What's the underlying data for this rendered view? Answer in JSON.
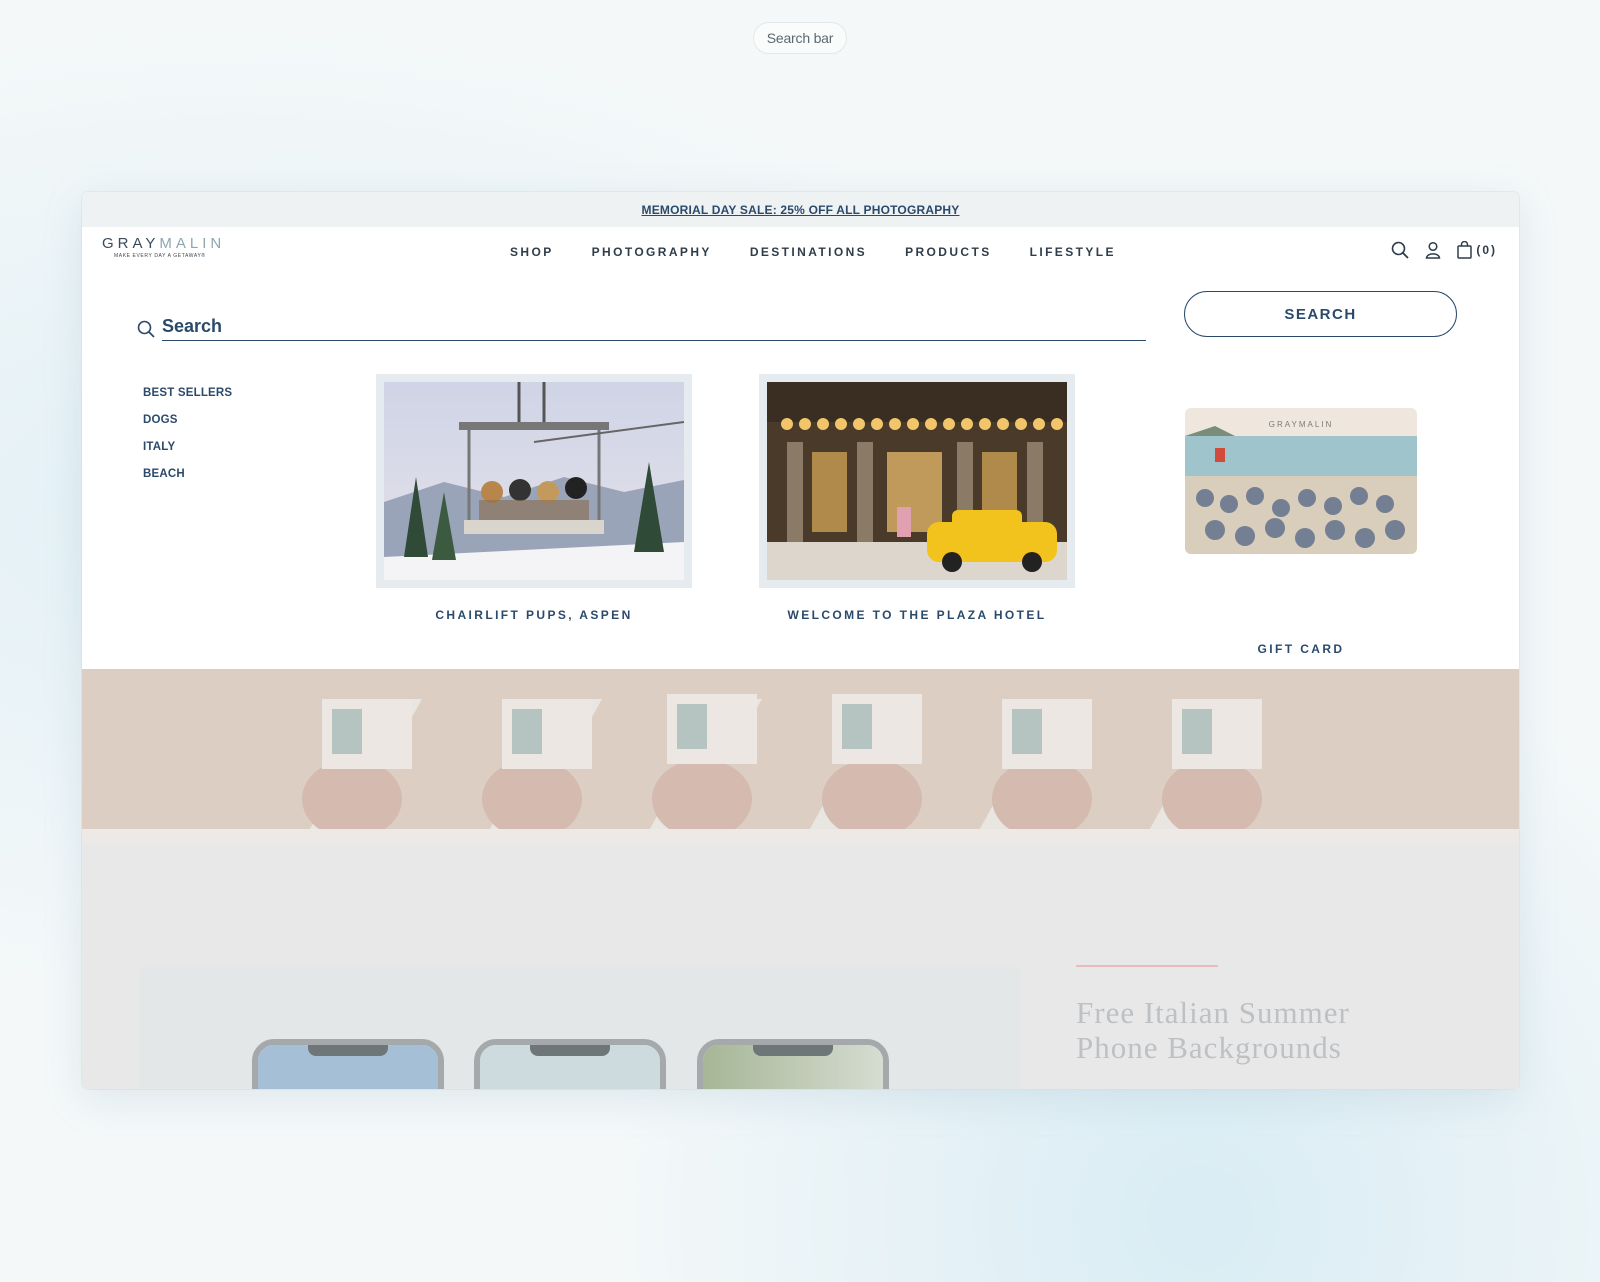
{
  "label_pill": "Search bar",
  "announcement": "MEMORIAL DAY SALE: 25% OFF ALL PHOTOGRAPHY",
  "logo": {
    "gray": "GRAY",
    "malin": "MALIN",
    "tagline": "MAKE EVERY DAY A GETAWAY®"
  },
  "nav": [
    "SHOP",
    "PHOTOGRAPHY",
    "DESTINATIONS",
    "PRODUCTS",
    "LIFESTYLE"
  ],
  "cart_count": "(0)",
  "search": {
    "placeholder": "Search",
    "button": "SEARCH"
  },
  "suggestions": [
    "BEST SELLERS",
    "DOGS",
    "ITALY",
    "BEACH"
  ],
  "products": [
    {
      "name": "CHAIRLIFT PUPS, ASPEN"
    },
    {
      "name": "WELCOME TO THE PLAZA HOTEL"
    },
    {
      "name": "GIFT CARD",
      "card_brand": "GRAYMALIN"
    }
  ],
  "promo": {
    "title_line1": "Free Italian Summer",
    "title_line2": "Phone Backgrounds"
  },
  "colors": {
    "brand_navy": "#2b4a6b",
    "accent": "#e79a8f"
  }
}
